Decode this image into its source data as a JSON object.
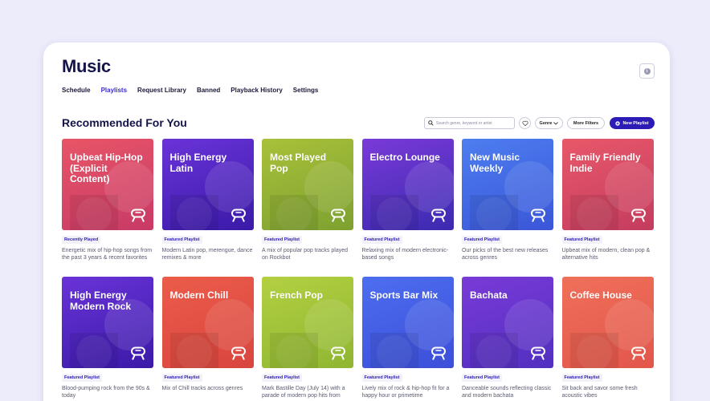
{
  "page": {
    "title": "Music"
  },
  "tabs": [
    {
      "label": "Schedule",
      "active": false
    },
    {
      "label": "Playlists",
      "active": true
    },
    {
      "label": "Request Library",
      "active": false
    },
    {
      "label": "Banned",
      "active": false
    },
    {
      "label": "Playback History",
      "active": false
    },
    {
      "label": "Settings",
      "active": false
    }
  ],
  "section": {
    "title": "Recommended For You"
  },
  "toolbar": {
    "search_placeholder": "Search genre, keyword or artist",
    "genre_label": "Genre",
    "filters_label": "More Filters",
    "new_playlist_label": "New Playlist"
  },
  "colors": {
    "accent": "#2d1bb5",
    "active_tab": "#3b2bd1"
  },
  "playlists": [
    {
      "title": "Upbeat Hip-Hop (Explicit Content)",
      "tag": "Recently Played",
      "desc": "Energetic mix of hip-hop songs from the past 3 years & recent favorites",
      "gradient": [
        "#e85567",
        "#c83a66"
      ]
    },
    {
      "title": "High Energy Latin",
      "tag": "Featured Playlist",
      "desc": "Modern Latin pop, merengue, dance remixes & more",
      "gradient": [
        "#6a33d8",
        "#3a1aa8"
      ]
    },
    {
      "title": "Most Played Pop",
      "tag": "Featured Playlist",
      "desc": "A mix of popular pop tracks played on Rockbot",
      "gradient": [
        "#a9c13a",
        "#7da130"
      ]
    },
    {
      "title": "Electro Lounge",
      "tag": "Featured Playlist",
      "desc": "Relaxing mix of modern electronic-based songs",
      "gradient": [
        "#7a3ad8",
        "#3b2ab0"
      ]
    },
    {
      "title": "New Music Weekly",
      "tag": "Featured Playlist",
      "desc": "Our picks of the best new releases across genres",
      "gradient": [
        "#4d7ef0",
        "#3a56d8"
      ]
    },
    {
      "title": "Family Friendly Indie",
      "tag": "Featured Playlist",
      "desc": "Upbeat mix of modern, clean pop & alternative hits",
      "gradient": [
        "#e8586a",
        "#c43c5e"
      ]
    },
    {
      "title": "High Energy Modern Rock",
      "tag": "Featured Playlist",
      "desc": "Blood-pumping rock from the 90s & today",
      "gradient": [
        "#6a33d8",
        "#3a1aa8"
      ]
    },
    {
      "title": "Modern Chill",
      "tag": "Featured Playlist",
      "desc": "Mix of Chill tracks across genres",
      "gradient": [
        "#ec5c4a",
        "#d8453e"
      ]
    },
    {
      "title": "French Pop",
      "tag": "Featured Playlist",
      "desc": "Mark Bastille Day (July 14) with a parade of modern pop hits from",
      "gradient": [
        "#b3d041",
        "#8fb632"
      ]
    },
    {
      "title": "Sports Bar Mix",
      "tag": "Featured Playlist",
      "desc": "Lively mix of rock & hip-hop fit for a happy hour or primetime",
      "gradient": [
        "#4d6ef0",
        "#3c4ed8"
      ]
    },
    {
      "title": "Bachata",
      "tag": "Featured Playlist",
      "desc": "Danceable sounds reflecting classic and modern bachata",
      "gradient": [
        "#7a3ad8",
        "#5130c0"
      ]
    },
    {
      "title": "Coffee House",
      "tag": "Featured Playlist",
      "desc": "Sit back and savor some fresh acoustic vibes",
      "gradient": [
        "#f0705a",
        "#e2564a"
      ]
    }
  ]
}
